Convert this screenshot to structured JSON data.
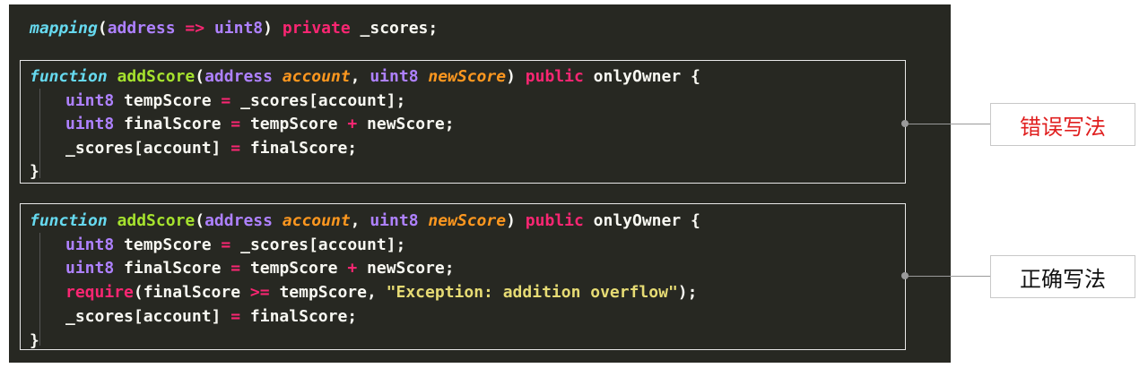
{
  "code": {
    "mapping_line": {
      "mapping": "mapping",
      "open": "(",
      "address": "address",
      "arrow": "=>",
      "uint8": "uint8",
      "close": ")",
      "private": "private",
      "rest": "_scores;"
    },
    "wrong_block": {
      "signature": {
        "function": "function",
        "name": "addScore",
        "open": "(",
        "address": "address",
        "account": "account",
        "comma": ",",
        "uint8": "uint8",
        "newScore": "newScore",
        "close": ")",
        "public": "public",
        "modifier": "onlyOwner {"
      },
      "line1": {
        "type": "uint8",
        "var": "tempScore",
        "eq": "=",
        "rest": "_scores[account];"
      },
      "line2": {
        "type": "uint8",
        "var": "finalScore",
        "eq": "=",
        "a": "tempScore",
        "plus": "+",
        "b": "newScore;"
      },
      "line3": {
        "lhs": "_scores[account]",
        "eq": "=",
        "rhs": "finalScore;"
      },
      "closing": "}"
    },
    "right_block": {
      "signature": {
        "function": "function",
        "name": "addScore",
        "open": "(",
        "address": "address",
        "account": "account",
        "comma": ",",
        "uint8": "uint8",
        "newScore": "newScore",
        "close": ")",
        "public": "public",
        "modifier": "onlyOwner {"
      },
      "line1": {
        "type": "uint8",
        "var": "tempScore",
        "eq": "=",
        "rest": "_scores[account];"
      },
      "line2": {
        "type": "uint8",
        "var": "finalScore",
        "eq": "=",
        "a": "tempScore",
        "plus": "+",
        "b": "newScore;"
      },
      "line3": {
        "require": "require",
        "open": "(finalScore",
        "gte": ">=",
        "mid": "tempScore,",
        "message": "\"Exception: addition overflow\"",
        "end": ");"
      },
      "line4": {
        "lhs": "_scores[account]",
        "eq": "=",
        "rhs": "finalScore;"
      },
      "closing": "}"
    }
  },
  "labels": {
    "wrong": "错误写法",
    "right": "正确写法"
  },
  "colors": {
    "background": "#272822",
    "type_keyword": "#66d9ef",
    "primitive": "#ae81ff",
    "operator_keyword": "#f92672",
    "function_name": "#a6e22e",
    "parameter": "#fd971f",
    "string": "#e6db74",
    "wrong_label": "#e02020"
  }
}
